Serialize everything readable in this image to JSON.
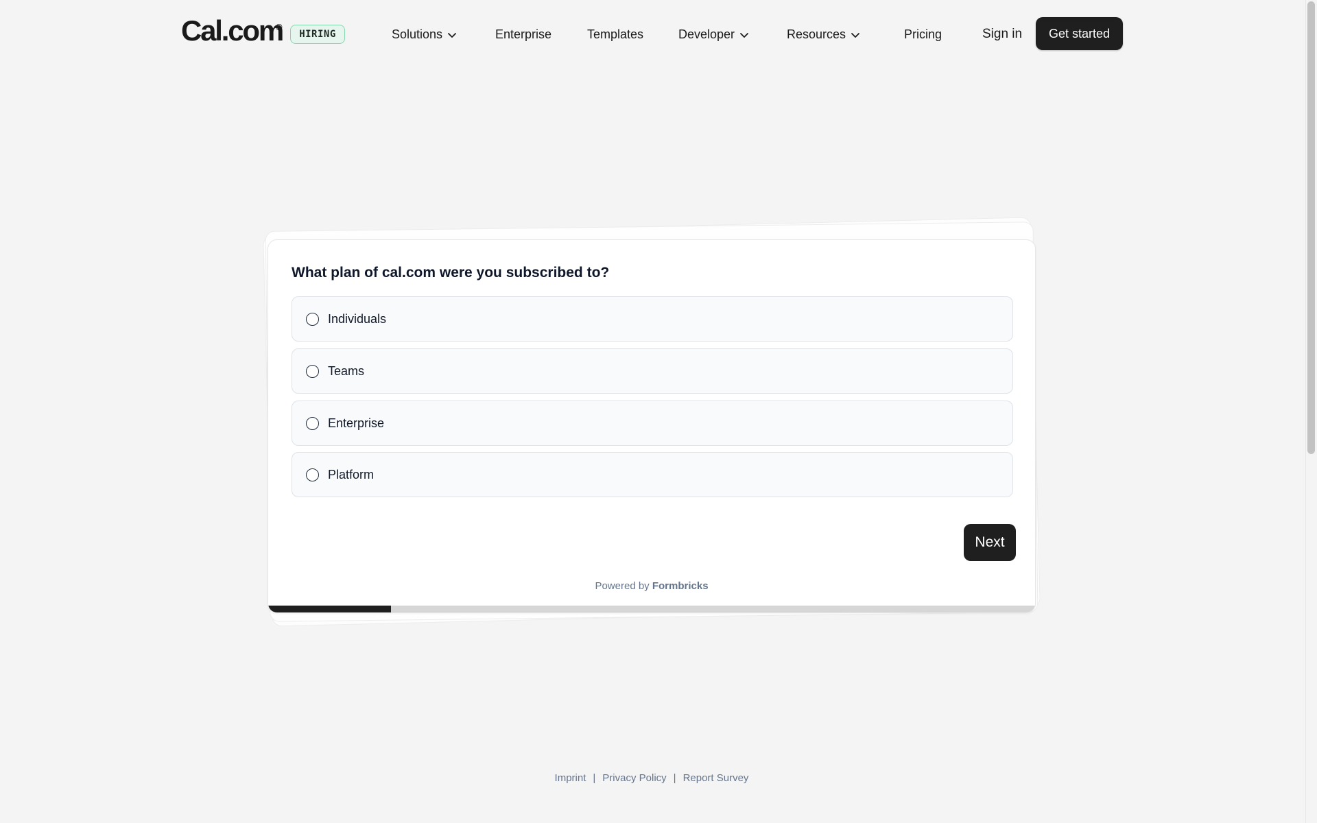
{
  "header": {
    "logo_text": "Cal.com",
    "logo_mark": "®",
    "badge": "HIRING",
    "nav": [
      {
        "label": "Solutions",
        "has_dropdown": true,
        "icon": "chevron-down-icon"
      },
      {
        "label": "Enterprise",
        "has_dropdown": false
      },
      {
        "label": "Templates",
        "has_dropdown": false
      },
      {
        "label": "Developer",
        "has_dropdown": true,
        "icon": "chevron-down-icon"
      },
      {
        "label": "Resources",
        "has_dropdown": true,
        "icon": "chevron-down-icon"
      },
      {
        "label": "Pricing",
        "has_dropdown": false
      }
    ],
    "sign_in": "Sign in",
    "get_started": "Get started"
  },
  "survey": {
    "question": "What plan of cal.com were you subscribed to?",
    "options": [
      {
        "label": "Individuals",
        "selected": false
      },
      {
        "label": "Teams",
        "selected": false
      },
      {
        "label": "Enterprise",
        "selected": false
      },
      {
        "label": "Platform",
        "selected": false
      }
    ],
    "next_label": "Next",
    "powered_prefix": "Powered by",
    "powered_brand": "Formbricks",
    "progress": 0.16
  },
  "footer": {
    "links": [
      "Imprint",
      "Privacy Policy",
      "Report Survey"
    ],
    "separator": "|"
  },
  "colors": {
    "page_bg": "#f4f4f4",
    "button_dark": "#1f1f1f",
    "badge_bg": "#e6f6ee",
    "badge_border": "#86d6ae",
    "option_bg": "#f8fafc",
    "option_border": "#dfe3e8",
    "muted_text": "#64748b"
  }
}
